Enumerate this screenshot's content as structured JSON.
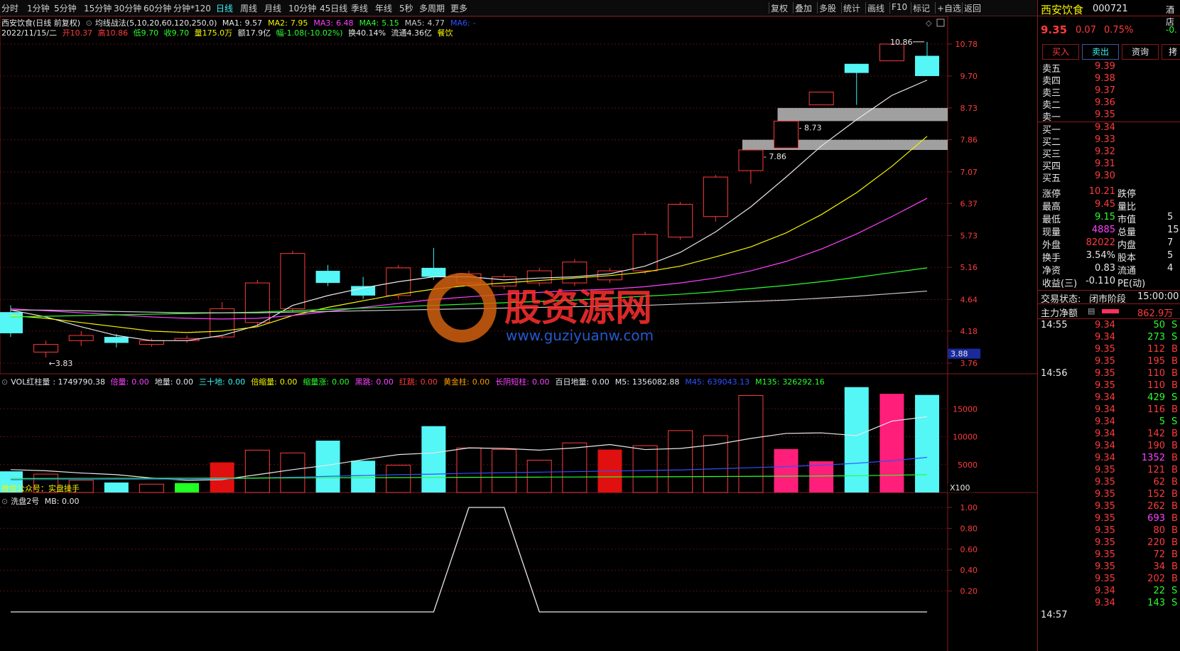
{
  "toolbar": {
    "periods": [
      "分时",
      "1分钟",
      "5分钟",
      "15分钟",
      "30分钟",
      "60分钟",
      "分钟*120",
      "日线",
      "周线",
      "月线",
      "10分钟",
      "45日线",
      "季线",
      "年线",
      "5秒",
      "多周期",
      "更多"
    ],
    "active_period": "日线",
    "right_buttons": [
      "复权",
      "叠加",
      "多股",
      "统计",
      "画线",
      "F10",
      "标记",
      "+自选",
      "返回"
    ]
  },
  "chart_header": {
    "stock_title": "西安饮食(日线 前复权)",
    "indicator": "均线战法(5,10,20,60,120,250,0)",
    "ma": [
      {
        "label": "MA1:",
        "value": "9.57",
        "color": "#e8e8e8"
      },
      {
        "label": "MA2:",
        "value": "7.95",
        "color": "#f5f500"
      },
      {
        "label": "MA3:",
        "value": "6.48",
        "color": "#ff40ff"
      },
      {
        "label": "MA4:",
        "value": "5.15",
        "color": "#2bff2b"
      },
      {
        "label": "MA5:",
        "value": "4.77",
        "color": "#c8c8c8"
      },
      {
        "label": "MA6:",
        "value": "-",
        "color": "#3050ff"
      }
    ],
    "info_date": "2022/11/15/二",
    "info_open": "开10.37",
    "info_high": "高10.86",
    "info_low": "低9.70",
    "info_close": "收9.70",
    "info_vol": "量175.0万",
    "info_amount": "额17.9亿",
    "info_change": "幅-1.08(-10.02%)",
    "info_turnover": "换40.14%",
    "info_float": "流通4.36亿",
    "info_sector": "餐饮"
  },
  "price_axis": {
    "ticks": [
      10.78,
      9.7,
      8.73,
      7.86,
      7.07,
      6.37,
      5.73,
      5.16,
      4.64,
      4.18,
      3.76
    ],
    "labels": [
      "10.78",
      "9.70",
      "8.73",
      "7.86",
      "7.07",
      "6.37",
      "5.73",
      "5.16",
      "4.64",
      "4.18",
      "3.76"
    ],
    "current_label": "3.88",
    "high_marker": "10.86",
    "low_marker": "3.83"
  },
  "zones": [
    {
      "label": "8.36 - 8.73",
      "low": 8.36,
      "high": 8.73
    },
    {
      "label": "7.60 - 7.86",
      "low": 7.6,
      "high": 7.86
    }
  ],
  "candles": [
    {
      "o": 4.15,
      "c": 4.45,
      "h": 4.55,
      "l": 4.1,
      "col": "cyan"
    },
    {
      "o": 3.9,
      "c": 4.0,
      "h": 4.05,
      "l": 3.83,
      "col": "red"
    },
    {
      "o": 4.05,
      "c": 4.12,
      "h": 4.18,
      "l": 3.98,
      "col": "red"
    },
    {
      "o": 4.1,
      "c": 4.02,
      "h": 4.14,
      "l": 3.96,
      "col": "cyan"
    },
    {
      "o": 4.0,
      "c": 4.05,
      "h": 4.08,
      "l": 3.97,
      "col": "red"
    },
    {
      "o": 4.05,
      "c": 4.08,
      "h": 4.12,
      "l": 4.02,
      "col": "red"
    },
    {
      "o": 4.1,
      "c": 4.5,
      "h": 4.6,
      "l": 4.08,
      "col": "red"
    },
    {
      "o": 4.3,
      "c": 4.9,
      "h": 4.95,
      "l": 4.25,
      "col": "red"
    },
    {
      "o": 4.5,
      "c": 5.4,
      "h": 5.45,
      "l": 4.45,
      "col": "red"
    },
    {
      "o": 5.1,
      "c": 4.9,
      "h": 5.2,
      "l": 4.85,
      "col": "cyan"
    },
    {
      "o": 4.85,
      "c": 4.7,
      "h": 5.0,
      "l": 4.65,
      "col": "cyan"
    },
    {
      "o": 4.7,
      "c": 5.15,
      "h": 5.2,
      "l": 4.65,
      "col": "red"
    },
    {
      "o": 5.15,
      "c": 5.0,
      "h": 5.5,
      "l": 4.95,
      "col": "cyan"
    },
    {
      "o": 4.9,
      "c": 5.05,
      "h": 5.1,
      "l": 4.85,
      "col": "red"
    },
    {
      "o": 4.85,
      "c": 5.0,
      "h": 5.05,
      "l": 4.8,
      "col": "red"
    },
    {
      "o": 4.9,
      "c": 5.1,
      "h": 5.15,
      "l": 4.85,
      "col": "red"
    },
    {
      "o": 4.9,
      "c": 5.25,
      "h": 5.3,
      "l": 4.85,
      "col": "red"
    },
    {
      "o": 4.95,
      "c": 5.1,
      "h": 5.15,
      "l": 4.9,
      "col": "red"
    },
    {
      "o": 5.1,
      "c": 5.75,
      "h": 5.8,
      "l": 5.05,
      "col": "red"
    },
    {
      "o": 5.7,
      "c": 6.35,
      "h": 6.4,
      "l": 5.65,
      "col": "red"
    },
    {
      "o": 6.1,
      "c": 6.95,
      "h": 7.0,
      "l": 6.0,
      "col": "red"
    },
    {
      "o": 7.1,
      "c": 7.6,
      "h": 7.62,
      "l": 6.8,
      "col": "red"
    },
    {
      "o": 7.65,
      "c": 8.36,
      "h": 8.36,
      "l": 7.65,
      "col": "red"
    },
    {
      "o": 8.82,
      "c": 9.2,
      "h": 9.2,
      "l": 8.82,
      "col": "red"
    },
    {
      "o": 10.1,
      "c": 9.8,
      "h": 10.1,
      "l": 8.82,
      "col": "cyan"
    },
    {
      "o": 10.2,
      "c": 10.78,
      "h": 10.78,
      "l": 10.2,
      "col": "red"
    },
    {
      "o": 10.37,
      "c": 9.7,
      "h": 10.86,
      "l": 9.7,
      "col": "cyan"
    }
  ],
  "ma_lines": {
    "ma1": [
      4.48,
      4.38,
      4.24,
      4.12,
      4.05,
      4.05,
      4.12,
      4.26,
      4.55,
      4.7,
      4.82,
      4.92,
      5.0,
      5.0,
      4.95,
      4.98,
      5.0,
      5.05,
      5.18,
      5.42,
      5.8,
      6.3,
      6.95,
      7.7,
      8.4,
      9.1,
      9.57
    ],
    "ma2": [
      4.4,
      4.36,
      4.3,
      4.24,
      4.18,
      4.16,
      4.18,
      4.24,
      4.4,
      4.52,
      4.62,
      4.72,
      4.8,
      4.86,
      4.9,
      4.94,
      4.98,
      5.02,
      5.08,
      5.18,
      5.34,
      5.52,
      5.78,
      6.14,
      6.6,
      7.2,
      7.95
    ],
    "ma3": [
      4.5,
      4.47,
      4.44,
      4.41,
      4.38,
      4.36,
      4.35,
      4.36,
      4.4,
      4.46,
      4.52,
      4.58,
      4.64,
      4.68,
      4.72,
      4.75,
      4.78,
      4.8,
      4.84,
      4.9,
      4.98,
      5.1,
      5.26,
      5.48,
      5.76,
      6.1,
      6.48
    ],
    "ma4": [
      4.38,
      4.39,
      4.4,
      4.41,
      4.42,
      4.43,
      4.44,
      4.45,
      4.47,
      4.49,
      4.51,
      4.53,
      4.55,
      4.57,
      4.59,
      4.61,
      4.63,
      4.66,
      4.69,
      4.72,
      4.76,
      4.81,
      4.86,
      4.92,
      4.99,
      5.07,
      5.15
    ],
    "ma5": [
      4.48,
      4.48,
      4.47,
      4.46,
      4.45,
      4.44,
      4.44,
      4.44,
      4.45,
      4.46,
      4.47,
      4.48,
      4.49,
      4.5,
      4.51,
      4.52,
      4.53,
      4.54,
      4.55,
      4.57,
      4.59,
      4.61,
      4.63,
      4.66,
      4.69,
      4.73,
      4.77
    ]
  },
  "vol_panel": {
    "title": "VOL红柱量",
    "value": ": 1749790.38",
    "items": [
      {
        "label": "倍量:",
        "value": "0.00",
        "color": "#ff40ff"
      },
      {
        "label": "地量:",
        "value": "0.00",
        "color": "#e8e8e8"
      },
      {
        "label": "三十地:",
        "value": "0.00",
        "color": "#3cf2f2"
      },
      {
        "label": "倍缩量:",
        "value": "0.00",
        "color": "#f5f500"
      },
      {
        "label": "缩量涨:",
        "value": "0.00",
        "color": "#2bff2b"
      },
      {
        "label": "黑跳:",
        "value": "0.00",
        "color": "#ff40ff"
      },
      {
        "label": "红跳:",
        "value": "0.00",
        "color": "#ff3b3b"
      },
      {
        "label": "黄金柱:",
        "value": "0.00",
        "color": "#ff9a00"
      },
      {
        "label": "长阴短柱:",
        "value": "0.00",
        "color": "#ff40ff"
      },
      {
        "label": "百日地量:",
        "value": "0.00",
        "color": "#e8e8e8"
      },
      {
        "label": "M5:",
        "value": "1356082.88",
        "color": "#e8e8e8"
      },
      {
        "label": "M45:",
        "value": "639043.13",
        "color": "#3050ff"
      },
      {
        "label": "M135:",
        "value": "326292.16",
        "color": "#2bff2b"
      }
    ],
    "axis_ticks": [
      15000,
      10000,
      5000
    ],
    "axis_labels": [
      "15000",
      "10000",
      "5000"
    ],
    "unit_label": "X100",
    "overlay_text": "微信公众号：实盘操手",
    "bars": [
      {
        "v": 3800,
        "t": "cyan"
      },
      {
        "v": 3300,
        "t": "red"
      },
      {
        "v": 2200,
        "t": "red"
      },
      {
        "v": 1800,
        "t": "cyan"
      },
      {
        "v": 1500,
        "t": "red"
      },
      {
        "v": 1700,
        "t": "green"
      },
      {
        "v": 5400,
        "t": "redfill"
      },
      {
        "v": 7600,
        "t": "red"
      },
      {
        "v": 7100,
        "t": "red"
      },
      {
        "v": 9300,
        "t": "cyan"
      },
      {
        "v": 5700,
        "t": "cyan"
      },
      {
        "v": 4900,
        "t": "red"
      },
      {
        "v": 11900,
        "t": "cyan"
      },
      {
        "v": 8000,
        "t": "red"
      },
      {
        "v": 7700,
        "t": "red"
      },
      {
        "v": 5800,
        "t": "red"
      },
      {
        "v": 8900,
        "t": "red"
      },
      {
        "v": 7700,
        "t": "redfill"
      },
      {
        "v": 8400,
        "t": "red"
      },
      {
        "v": 11100,
        "t": "red"
      },
      {
        "v": 10200,
        "t": "red"
      },
      {
        "v": 17400,
        "t": "red"
      },
      {
        "v": 7800,
        "t": "pink"
      },
      {
        "v": 5600,
        "t": "pink"
      },
      {
        "v": 18900,
        "t": "cyan"
      },
      {
        "v": 17700,
        "t": "pink"
      },
      {
        "v": 17500,
        "t": "cyan"
      }
    ],
    "m5": [
      4100,
      3900,
      3500,
      3200,
      2600,
      2200,
      2300,
      3200,
      4100,
      4900,
      5900,
      6800,
      7100,
      8000,
      7900,
      7600,
      8000,
      8600,
      7700,
      7900,
      8600,
      9700,
      10600,
      10700,
      10200,
      12800,
      13600
    ],
    "m45": [
      2300,
      2320,
      2340,
      2360,
      2380,
      2400,
      2450,
      2600,
      2750,
      2900,
      3050,
      3200,
      3300,
      3450,
      3550,
      3650,
      3750,
      3850,
      3950,
      4050,
      4250,
      4450,
      4650,
      4900,
      5250,
      5700,
      6300
    ],
    "m135": [
      2500,
      2520,
      2540,
      2550,
      2560,
      2570,
      2580,
      2600,
      2620,
      2640,
      2660,
      2680,
      2700,
      2720,
      2740,
      2760,
      2780,
      2800,
      2820,
      2840,
      2870,
      2900,
      2930,
      2960,
      3000,
      3100,
      3200
    ]
  },
  "wash_panel": {
    "title": "洗盘2号",
    "value": "MB: 0.00",
    "axis_ticks": [
      1.0,
      0.8,
      0.6,
      0.4,
      0.2
    ],
    "axis_labels": [
      "1.00",
      "0.80",
      "0.60",
      "0.40",
      "0.20"
    ],
    "series": [
      0,
      0,
      0,
      0,
      0,
      0,
      0,
      0,
      0,
      0,
      0,
      0,
      0,
      1,
      1,
      0,
      0,
      0,
      0,
      0,
      0,
      0,
      0,
      0,
      0,
      0,
      0
    ]
  },
  "watermark": {
    "text_cn": "股资源网",
    "text_url": "www.guziyuanw.com"
  },
  "right_panel": {
    "name": "西安饮食",
    "code": "000721",
    "sector_tag": "酒店",
    "price": "9.35",
    "change": "0.07",
    "pct": "0.75%",
    "extra_pct": "-0.",
    "buttons": [
      "买入",
      "卖出",
      "资询",
      "拷"
    ],
    "asks": [
      {
        "label": "卖五",
        "price": "9.39"
      },
      {
        "label": "卖四",
        "price": "9.38"
      },
      {
        "label": "卖三",
        "price": "9.37"
      },
      {
        "label": "卖二",
        "price": "9.36"
      },
      {
        "label": "卖一",
        "price": "9.35"
      }
    ],
    "bids": [
      {
        "label": "买一",
        "price": "9.34"
      },
      {
        "label": "买二",
        "price": "9.33"
      },
      {
        "label": "买三",
        "price": "9.32"
      },
      {
        "label": "买四",
        "price": "9.31"
      },
      {
        "label": "买五",
        "price": "9.30"
      }
    ],
    "stats": [
      {
        "label": "涨停",
        "value": "10.21",
        "color": "#ff3b3b",
        "label2": "跌停",
        "value2": ""
      },
      {
        "label": "最高",
        "value": "9.45",
        "color": "#ff3b3b",
        "label2": "量比",
        "value2": ""
      },
      {
        "label": "最低",
        "value": "9.15",
        "color": "#2bff2b",
        "label2": "市值",
        "value2": "5"
      },
      {
        "label": "现量",
        "value": "4885",
        "color": "#ff40ff",
        "label2": "总量",
        "value2": "15"
      },
      {
        "label": "外盘",
        "value": "82022",
        "color": "#ff3b3b",
        "label2": "内盘",
        "value2": "7"
      },
      {
        "label": "换手",
        "value": "3.54%",
        "color": "#e8e8e8",
        "label2": "股本",
        "value2": "5"
      },
      {
        "label": "净资",
        "value": "0.83",
        "color": "#e8e8e8",
        "label2": "流通",
        "value2": "4"
      },
      {
        "label": "收益(三)",
        "value": "-0.110",
        "color": "#e8e8e8",
        "label2": "PE(动)",
        "value2": ""
      }
    ],
    "trade_status_label": "交易状态:",
    "trade_status": "闭市阶段",
    "trade_time": "15:00:00",
    "main_net_label": "主力净额",
    "main_net_value": "862.9万",
    "ticks": [
      {
        "time": "14:55",
        "price": "9.34",
        "vol": "50",
        "side": "S"
      },
      {
        "time": "",
        "price": "9.34",
        "vol": "273",
        "side": "S"
      },
      {
        "time": "",
        "price": "9.35",
        "vol": "112",
        "side": "B"
      },
      {
        "time": "",
        "price": "9.35",
        "vol": "195",
        "side": "B"
      },
      {
        "time": "14:56",
        "price": "9.35",
        "vol": "110",
        "side": "B"
      },
      {
        "time": "",
        "price": "9.35",
        "vol": "110",
        "side": "B"
      },
      {
        "time": "",
        "price": "9.34",
        "vol": "429",
        "side": "S"
      },
      {
        "time": "",
        "price": "9.34",
        "vol": "116",
        "side": "B"
      },
      {
        "time": "",
        "price": "9.34",
        "vol": "5",
        "side": "S"
      },
      {
        "time": "",
        "price": "9.34",
        "vol": "142",
        "side": "B"
      },
      {
        "time": "",
        "price": "9.34",
        "vol": "190",
        "side": "B"
      },
      {
        "time": "",
        "price": "9.34",
        "vol": "1352",
        "side": "B"
      },
      {
        "time": "",
        "price": "9.35",
        "vol": "121",
        "side": "B"
      },
      {
        "time": "",
        "price": "9.35",
        "vol": "62",
        "side": "B"
      },
      {
        "time": "",
        "price": "9.35",
        "vol": "152",
        "side": "B"
      },
      {
        "time": "",
        "price": "9.35",
        "vol": "262",
        "side": "B"
      },
      {
        "time": "",
        "price": "9.35",
        "vol": "693",
        "side": "B"
      },
      {
        "time": "",
        "price": "9.35",
        "vol": "80",
        "side": "B"
      },
      {
        "time": "",
        "price": "9.35",
        "vol": "220",
        "side": "B"
      },
      {
        "time": "",
        "price": "9.35",
        "vol": "72",
        "side": "B"
      },
      {
        "time": "",
        "price": "9.35",
        "vol": "34",
        "side": "B"
      },
      {
        "time": "",
        "price": "9.35",
        "vol": "202",
        "side": "B"
      },
      {
        "time": "",
        "price": "9.34",
        "vol": "22",
        "side": "S"
      },
      {
        "time": "",
        "price": "9.34",
        "vol": "143",
        "side": "S"
      },
      {
        "time": "14:57",
        "price": "",
        "vol": "",
        "side": ""
      }
    ]
  }
}
